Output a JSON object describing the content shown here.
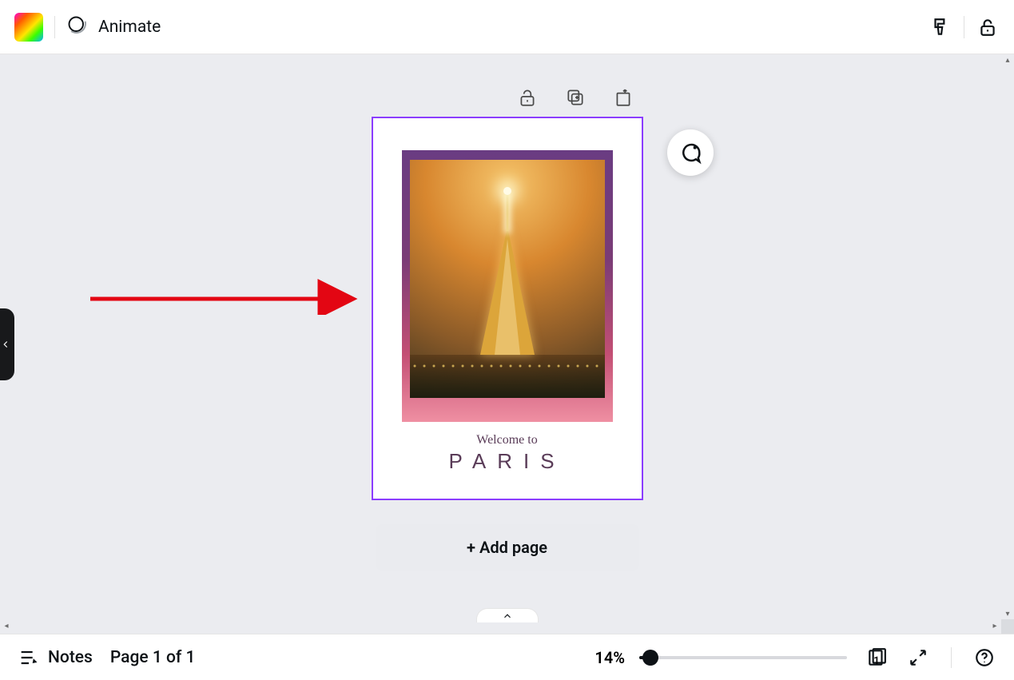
{
  "toolbar": {
    "animate_label": "Animate"
  },
  "page_controls": {},
  "canvas": {
    "welcome_text": "Welcome to",
    "title_text": "PARIS"
  },
  "add_page_label": "+ Add page",
  "bottom": {
    "notes_label": "Notes",
    "page_counter": "Page 1 of 1",
    "zoom_pct": "14%",
    "grid_count": "1"
  }
}
